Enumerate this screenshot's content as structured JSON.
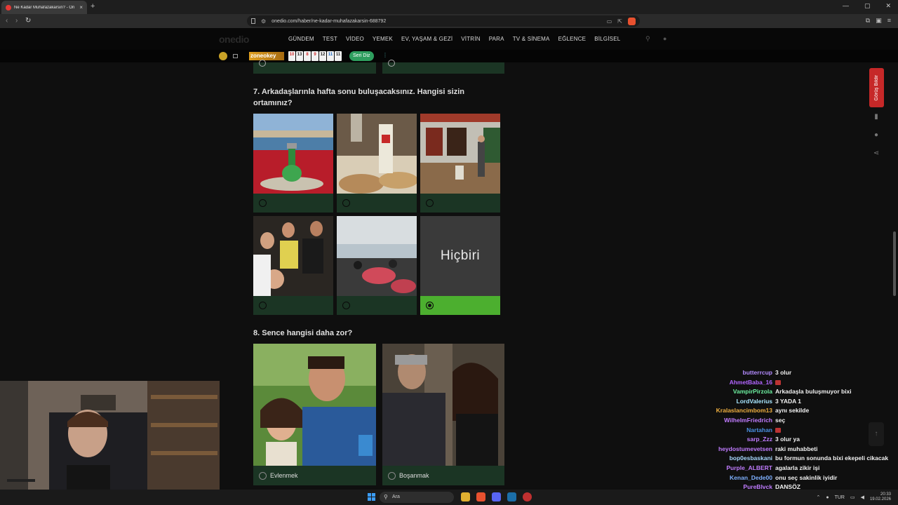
{
  "browser": {
    "tab_title": "Ne Kadar Muhafazakarsın? - On",
    "tab_close": "×",
    "new_tab": "+",
    "url": "onedio.com/haber/ne-kadar-muhafazakarsin-688792",
    "window_controls": [
      "—",
      "▢",
      "✕"
    ]
  },
  "site": {
    "logo": "onedio",
    "menu": [
      "GÜNDEM",
      "TEST",
      "VİDEO",
      "YEMEK",
      "EV, YAŞAM & GEZİ",
      "VİTRİN",
      "PARA",
      "TV & SİNEMA",
      "EĞLENCE",
      "BİLGİSEL"
    ]
  },
  "ad": {
    "zone": "zoneokey",
    "tiles": [
      {
        "n": "10",
        "color": "#d32f2f"
      },
      {
        "n": "13",
        "color": "#222222"
      },
      {
        "n": "8",
        "color": "#d32f2f"
      },
      {
        "n": "9",
        "color": "#d32f2f"
      },
      {
        "n": "12",
        "color": "#222222"
      },
      {
        "n": "11",
        "color": "#1565c0"
      },
      {
        "n": "11",
        "color": "#222222"
      }
    ],
    "button": "Seri Diz"
  },
  "quiz": {
    "q7": {
      "title": "7. Arkadaşlarınla hafta sonu buluşacaksınız. Hangisi sizin ortamınız?",
      "none_label": "Hiçbiri",
      "selected_index": 5
    },
    "q8": {
      "title": "8. Sence hangisi daha zor?",
      "options": [
        "Evlenmek",
        "Boşanmak"
      ]
    }
  },
  "side": {
    "feedback": "Görüş Bildir",
    "scroll_top": "↑"
  },
  "chat": [
    {
      "user": "butterrcup",
      "color": "#b48cff",
      "text": "3 olur"
    },
    {
      "user": "AhmetBaba_16",
      "color": "#b266ff",
      "text": "",
      "emote": true
    },
    {
      "user": "VampirPirzola",
      "color": "#6cf0a0",
      "text": "Arkadaşla buluşmuyor bixi"
    },
    {
      "user": "LordValerius",
      "color": "#a8e6ff",
      "text": "3 YADA 1"
    },
    {
      "user": "Kralaslancimbom13",
      "color": "#f0b040",
      "text": "aynı sekilde"
    },
    {
      "user": "WilhelmFriedrich",
      "color": "#c07cff",
      "text": "seç"
    },
    {
      "user": "Nartahan",
      "color": "#4a90e2",
      "text": "",
      "emote": true
    },
    {
      "user": "sarp_Zzz",
      "color": "#c07cff",
      "text": "3 olur ya"
    },
    {
      "user": "heydostumevetsen",
      "color": "#c07cff",
      "text": "raki muhabbeti"
    },
    {
      "user": "bop0esbaskani",
      "color": "#a8d8ff",
      "text": "bu formun sonunda bixi ekepeli cikacak"
    },
    {
      "user": "Purple_ALBERT",
      "color": "#c07cff",
      "text": "agalarla zikir işi"
    },
    {
      "user": "Kenan_Dede00",
      "color": "#7fb0ff",
      "text": "onu seç sakinlik iyidir"
    },
    {
      "user": "PureBlvck",
      "color": "#c07cff",
      "text": "DANSÖZ"
    }
  ],
  "taskbar": {
    "search": "Ara",
    "lang": "TUR",
    "time": "20:33",
    "date": "19.02.2026"
  }
}
